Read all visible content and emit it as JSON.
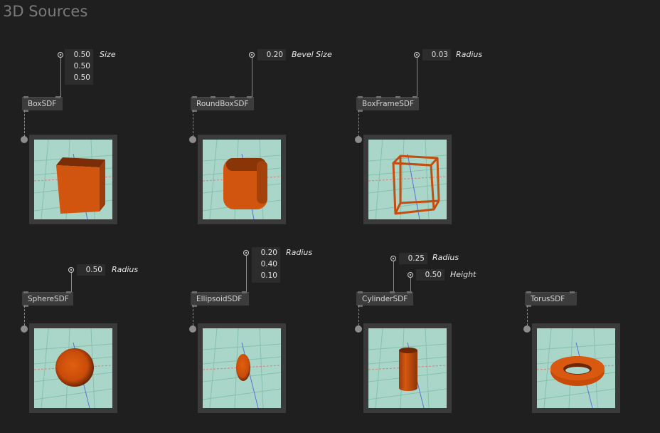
{
  "title": "3D Sources",
  "nodes": {
    "box": {
      "label": "BoxSDF",
      "param": "Size",
      "values": [
        "0.50",
        "0.50",
        "0.50"
      ]
    },
    "roundbox": {
      "label": "RoundBoxSDF",
      "param": "Bevel Size",
      "values": [
        "0.20"
      ]
    },
    "boxframe": {
      "label": "BoxFrameSDF",
      "param": "Radius",
      "values": [
        "0.03"
      ]
    },
    "sphere": {
      "label": "SphereSDF",
      "param": "Radius",
      "values": [
        "0.50"
      ]
    },
    "ellipsoid": {
      "label": "EllipsoidSDF",
      "param": "Radius",
      "values": [
        "0.20",
        "0.40",
        "0.10"
      ]
    },
    "cylinder": {
      "label": "CylinderSDF",
      "param1": "Radius",
      "values1": [
        "0.25"
      ],
      "param2": "Height",
      "values2": [
        "0.50"
      ]
    },
    "torus": {
      "label": "TorusSDF"
    }
  },
  "colors": {
    "background": "#1f1f1f",
    "preview_bg": "#a9d6c8",
    "shape": "#d2550f"
  }
}
